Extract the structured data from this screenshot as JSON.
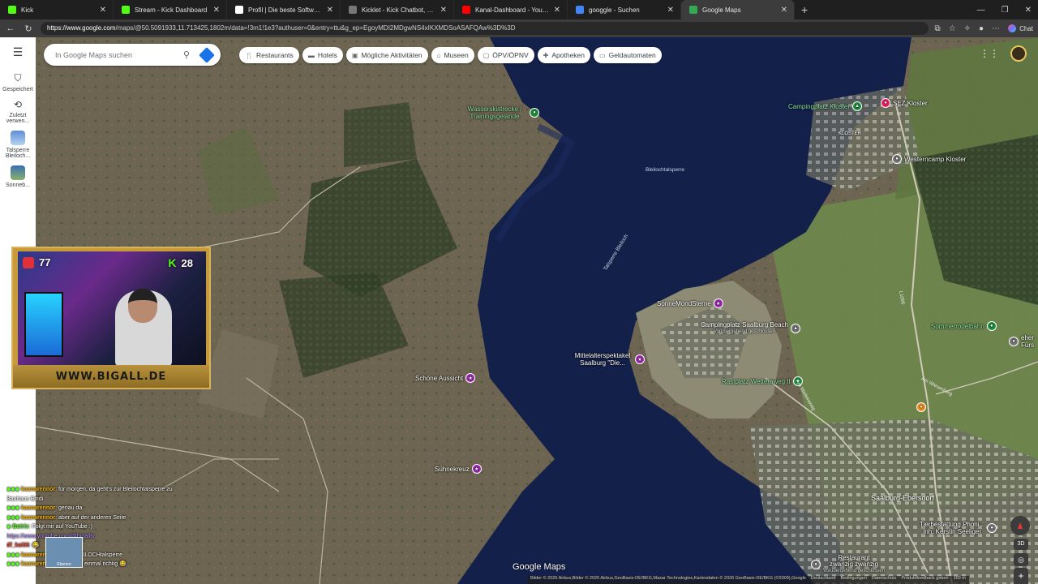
{
  "tabs": [
    {
      "title": "Kick",
      "color": "#53fc18",
      "active": false
    },
    {
      "title": "Stream - Kick Dashboard",
      "color": "#53fc18",
      "active": false
    },
    {
      "title": "Profil | Die beste Software zur Opt",
      "color": "#ffffff",
      "active": false
    },
    {
      "title": "Kicklet - Kick Chatbot, Kick Widge",
      "color": "#777777",
      "active": false
    },
    {
      "title": "Kanal-Dashboard - YouTube Studi",
      "color": "#ff0000",
      "active": false
    },
    {
      "title": "googgle - Suchen",
      "color": "#4285f4",
      "active": false
    },
    {
      "title": "Google Maps",
      "color": "#34a853",
      "active": true
    }
  ],
  "address": {
    "host": "https://www.google.com",
    "path": "/maps/@50.5091933,11.713425,1802m/data=!3m1!1e3?authuser=0&entry=ttu&g_ep=EgoyMDI2MDgwNS4xIKXMDSoASAFQAw%3D%3D"
  },
  "browser": {
    "chat_label": "Chat"
  },
  "rail": {
    "saved": "Gespeichert",
    "recent": "Zuletzt verwen...",
    "place1": "Talsperre Bleiloch...",
    "place2": "Sonneb..."
  },
  "search": {
    "placeholder": "In Google Maps suchen"
  },
  "chips": [
    {
      "label": "Restaurants",
      "icon": "fork-knife-icon"
    },
    {
      "label": "Hotels",
      "icon": "bed-icon"
    },
    {
      "label": "Mögliche Aktivitäten",
      "icon": "ticket-icon"
    },
    {
      "label": "Museen",
      "icon": "museum-icon"
    },
    {
      "label": "ÖPV/ÖPNV",
      "icon": "bus-icon"
    },
    {
      "label": "Apotheken",
      "icon": "pharmacy-icon"
    },
    {
      "label": "Geldautomaten",
      "icon": "atm-icon"
    }
  ],
  "places": {
    "wasserski": "Wasserskistrecke / Trainingsgelände",
    "campingkloster": "Campingplatz Kloster",
    "sez": "SEZ Kloster",
    "kloster": "KLOSTER",
    "westerncamp": "Westerncamp Kloster",
    "bleilochtalsperre": "Bleilochtalsperre",
    "talsperre": "Talsperre Bleiloch",
    "sonnemond": "SonneMondSterne",
    "camping_saalburg": "Campingplatz Saalburg Beach",
    "camping_saalburg_sub": "Vorübergehend geschlossen",
    "mittelalter": "Mittelalterspektakel Saalburg \"Die...",
    "schoene": "Schöne Aussicht",
    "rastplatz": "Rastplatz Wetteraweg II",
    "sommerrodel": "Sommerrodelbahn",
    "suehnekreuz": "Sühnekreuz",
    "saalburg": "Saalburg-Ebersdorf",
    "tierbestattung": "Tierbestattung Phoni...",
    "tierbestattung_sub": "Inh. Kerstin Seeliger",
    "restaurant": "Restaurant",
    "restaurant_sub": "zwanzig zwanzig",
    "restaurant_sub2": "Vorübergehend geschlossen",
    "eher": "eher",
    "fuers": "Fürs",
    "road1": "L1095",
    "road2": "Am Wetteraweg",
    "road3": "Am Wiesenberg"
  },
  "map": {
    "logo": "Google Maps",
    "attribution": "Bilder © 2026 Airbus,Bilder © 2026 Airbus,GeoBasis-DE/BKG,Maxar Technologies,Kartendaten © 2026 GeoBasis-DE/BKG (©2009),Google",
    "links": [
      "Deutschland",
      "Bedingungen",
      "Datenschutz",
      "Produktfeedback geben"
    ],
    "scale": "100 m",
    "btn3d": "3D"
  },
  "overlay": {
    "hearts": "77",
    "kick_count": "28",
    "banner": "WWW.BIGALL.DE"
  },
  "chat": [
    {
      "user": "kaanarennor",
      "text": ": für morgen, da geht's zur Bleilochtalsperre zu",
      "cls": ""
    },
    {
      "user": "",
      "text": "Bauhaus Bindi",
      "cls": ""
    },
    {
      "user": "kaanarennor",
      "text": ": genau da",
      "cls": ""
    },
    {
      "user": "kaanarennor",
      "text": ": aber auf der anderen Seite",
      "cls": ""
    },
    {
      "user": "Botrix",
      "text": ": Folgt mir auf YouTube :)",
      "cls": "b"
    },
    {
      "user": "",
      "text": "https://www.youtube.com/@bigalltv",
      "cls": "link"
    },
    {
      "user": "df_kai66",
      "text": ": 😂",
      "cls": "c"
    },
    {
      "user": "kaanarennor",
      "text": ": Jupp BLEILOCHtalsperre",
      "cls": ""
    },
    {
      "user": "kaanarennor",
      "text": ": Lies doch einmal richtig 😂",
      "cls": ""
    }
  ],
  "chat_thumb_label": "Ebenen"
}
